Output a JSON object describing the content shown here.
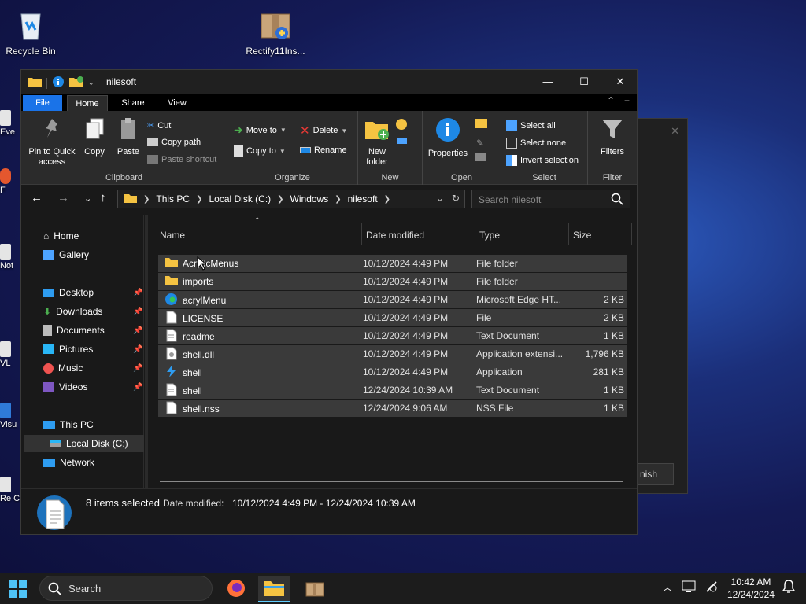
{
  "desktop": {
    "icons": [
      {
        "label": "Recycle Bin"
      },
      {
        "label": "Rectify11Ins..."
      }
    ],
    "partial_icons": [
      "Eve",
      "F",
      "Not",
      "VL",
      "Visu",
      "Re Cl"
    ],
    "ghost_dialog_button": "nish"
  },
  "window": {
    "title": "nilesoft",
    "controls": {
      "minimize": "—",
      "maximize": "☐",
      "close": "✕"
    }
  },
  "ribbon": {
    "tabs": [
      "File",
      "Home",
      "Share",
      "View"
    ],
    "clipboard": {
      "label": "Clipboard",
      "pin": "Pin to Quick access",
      "copy": "Copy",
      "paste": "Paste",
      "cut": "Cut",
      "copy_path": "Copy path",
      "paste_shortcut": "Paste shortcut"
    },
    "organize": {
      "label": "Organize",
      "move_to": "Move to",
      "copy_to": "Copy to",
      "delete": "Delete",
      "rename": "Rename"
    },
    "new": {
      "label": "New",
      "new_folder": "New folder"
    },
    "open": {
      "label": "Open",
      "properties": "Properties"
    },
    "select": {
      "label": "Select",
      "select_all": "Select all",
      "select_none": "Select none",
      "invert": "Invert selection"
    },
    "filter": {
      "label": "Filter",
      "filters": "Filters"
    }
  },
  "address": {
    "crumbs": [
      "This PC",
      "Local Disk (C:)",
      "Windows",
      "nilesoft"
    ],
    "search_placeholder": "Search nilesoft"
  },
  "nav_pane": {
    "items": [
      {
        "label": "Home",
        "pinned": false
      },
      {
        "label": "Gallery",
        "pinned": false
      },
      {
        "label": "Desktop",
        "pinned": true
      },
      {
        "label": "Downloads",
        "pinned": true
      },
      {
        "label": "Documents",
        "pinned": true
      },
      {
        "label": "Pictures",
        "pinned": true
      },
      {
        "label": "Music",
        "pinned": true
      },
      {
        "label": "Videos",
        "pinned": true
      },
      {
        "label": "This PC",
        "pinned": false
      },
      {
        "label": "Local Disk (C:)",
        "pinned": false
      },
      {
        "label": "Network",
        "pinned": false
      }
    ]
  },
  "columns": [
    "Name",
    "Date modified",
    "Type",
    "Size"
  ],
  "files": [
    {
      "name": "AcrylicMenus",
      "date": "10/12/2024 4:49 PM",
      "type": "File folder",
      "size": "",
      "icon": "folder-icon"
    },
    {
      "name": "imports",
      "date": "10/12/2024 4:49 PM",
      "type": "File folder",
      "size": "",
      "icon": "folder-icon"
    },
    {
      "name": "acrylMenu",
      "date": "10/12/2024 4:49 PM",
      "type": "Microsoft Edge HT...",
      "size": "2 KB",
      "icon": "edge-icon"
    },
    {
      "name": "LICENSE",
      "date": "10/12/2024 4:49 PM",
      "type": "File",
      "size": "2 KB",
      "icon": "file-icon"
    },
    {
      "name": "readme",
      "date": "10/12/2024 4:49 PM",
      "type": "Text Document",
      "size": "1 KB",
      "icon": "text-file-icon"
    },
    {
      "name": "shell.dll",
      "date": "10/12/2024 4:49 PM",
      "type": "Application extensi...",
      "size": "1,796 KB",
      "icon": "dll-icon"
    },
    {
      "name": "shell",
      "date": "10/12/2024 4:49 PM",
      "type": "Application",
      "size": "281 KB",
      "icon": "app-icon"
    },
    {
      "name": "shell",
      "date": "12/24/2024 10:39 AM",
      "type": "Text Document",
      "size": "1 KB",
      "icon": "text-file-icon"
    },
    {
      "name": "shell.nss",
      "date": "12/24/2024 9:06 AM",
      "type": "NSS File",
      "size": "1 KB",
      "icon": "file-icon"
    }
  ],
  "details": {
    "count": "8 items selected",
    "date_label": "Date modified:",
    "date_value": "10/12/2024 4:49 PM - 12/24/2024 10:39 AM"
  },
  "taskbar": {
    "search_placeholder": "Search",
    "time": "10:42 AM",
    "date": "12/24/2024"
  },
  "colors": {
    "accent": "#1a73e8",
    "folder": "#f5c342",
    "row_selected": "#3a3a3a"
  }
}
